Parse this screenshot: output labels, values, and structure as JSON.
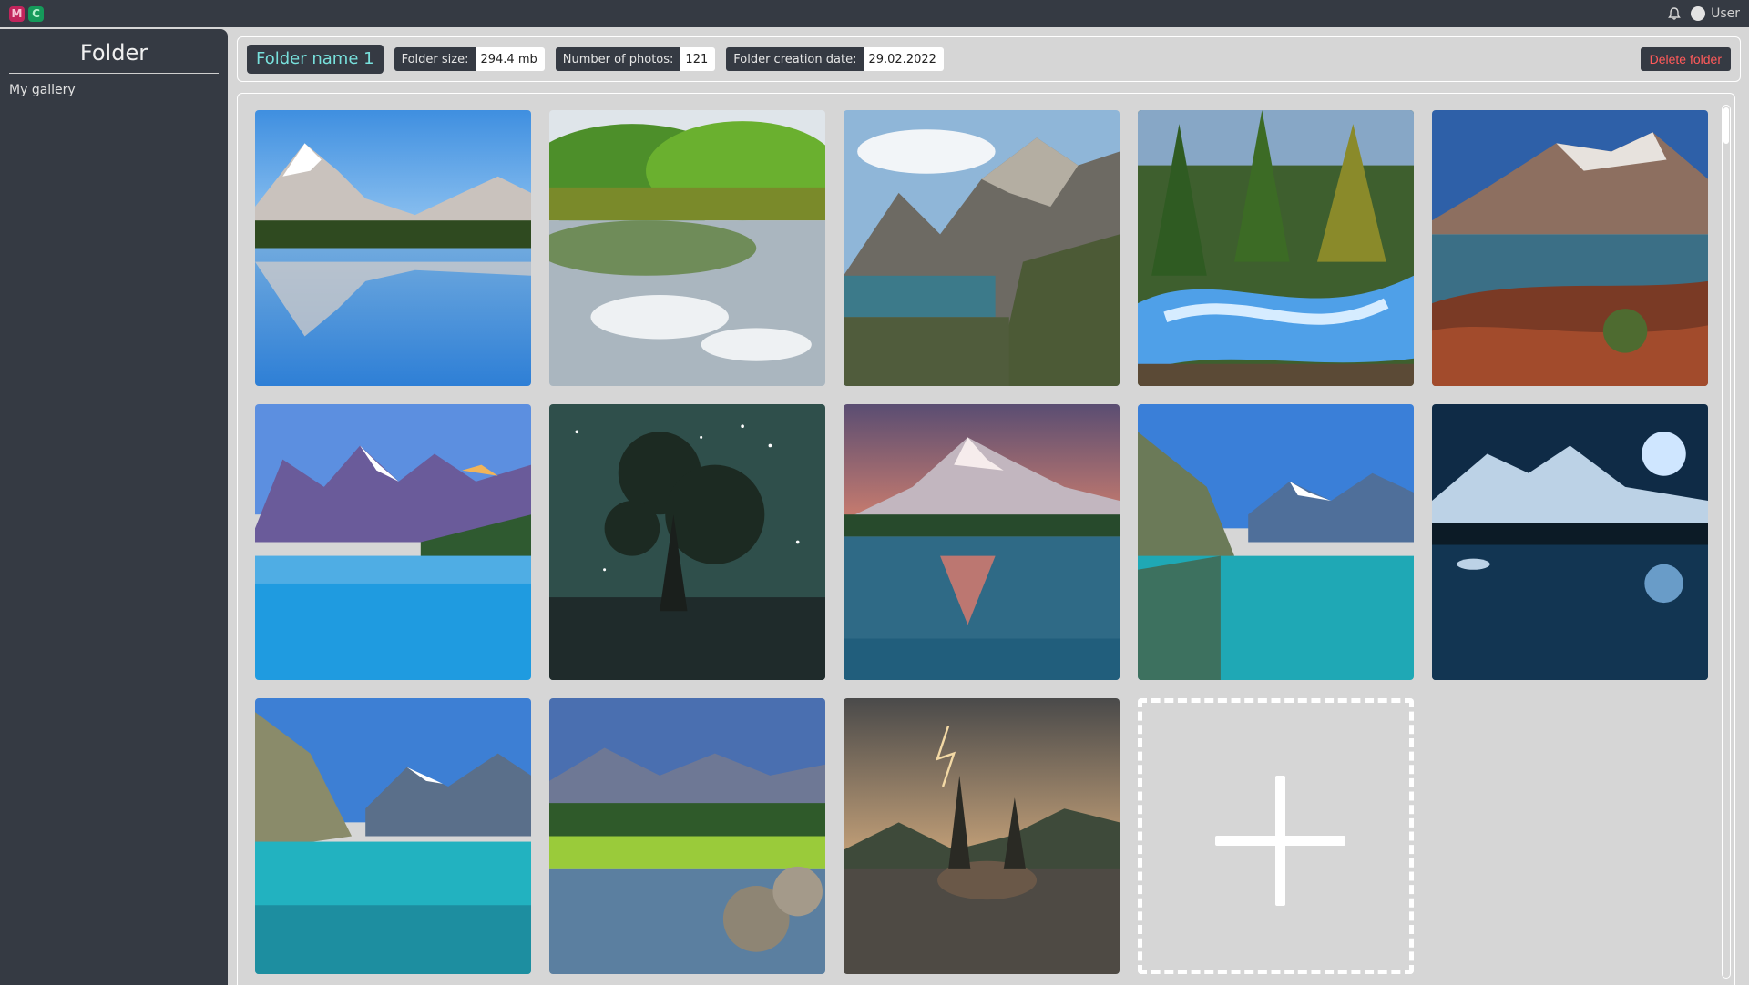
{
  "topbar": {
    "logo_left": "M",
    "logo_right": "C",
    "user_label": "User",
    "icons": [
      "bell-icon",
      "user-avatar"
    ]
  },
  "sidebar": {
    "title": "Folder",
    "items": [
      {
        "label": "My gallery"
      }
    ]
  },
  "folder": {
    "name": "Folder name 1",
    "size_label": "Folder size:",
    "size_value": "294.4 mb",
    "photos_label": "Number of photos:",
    "photos_value": "121",
    "date_label": "Folder creation date:",
    "date_value": "29.02.2022",
    "delete_label": "Delete folder"
  },
  "colors": {
    "dark": "#353a43",
    "accent": "#78e0dc",
    "danger": "#ff5a5a",
    "panel": "#d6d6d6"
  },
  "gallery": {
    "photos": [
      {
        "name": "photo-mountain-lake-reflection"
      },
      {
        "name": "photo-forest-lake-clouds"
      },
      {
        "name": "photo-rocky-peaks-lake"
      },
      {
        "name": "photo-forest-waterfall"
      },
      {
        "name": "photo-glacier-lake-red-brush"
      },
      {
        "name": "photo-moraine-lake"
      },
      {
        "name": "photo-starry-night-tree"
      },
      {
        "name": "photo-sunset-mountain-reflection"
      },
      {
        "name": "photo-turquoise-valley-lake"
      },
      {
        "name": "photo-moonlit-mountain-lake"
      },
      {
        "name": "photo-turquoise-lake-cliffs"
      },
      {
        "name": "photo-alpine-meadow-creek"
      },
      {
        "name": "photo-stormy-island-trees"
      }
    ],
    "add_tile_icon": "plus-icon"
  }
}
